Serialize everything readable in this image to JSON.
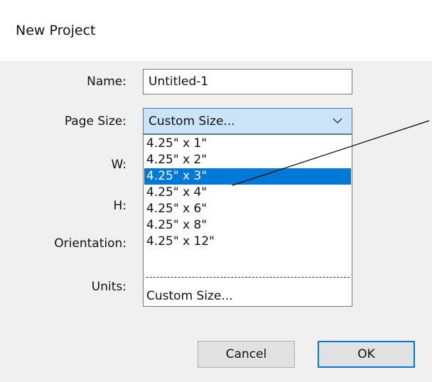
{
  "dialog": {
    "title": "New Project"
  },
  "form": {
    "name_label": "Name:",
    "name_value": "Untitled-1",
    "page_size_label": "Page Size:",
    "page_size_value": "Custom Size...",
    "w_label": "W:",
    "h_label": "H:",
    "orientation_label": "Orientation:",
    "units_label": "Units:"
  },
  "dropdown": {
    "items": [
      {
        "label": "4.25\" x 1\""
      },
      {
        "label": "4.25\" x 2\""
      },
      {
        "label": "4.25\" x 3\""
      },
      {
        "label": "4.25\" x 4\""
      },
      {
        "label": "4.25\" x 6\""
      },
      {
        "label": "4.25\" x 8\""
      },
      {
        "label": "4.25\" x 12\""
      }
    ],
    "selected_index": 2,
    "custom_label": "Custom Size..."
  },
  "buttons": {
    "cancel": "Cancel",
    "ok": "OK"
  },
  "colors": {
    "selection": "#0078d7",
    "combo_highlight": "#cce4f7"
  },
  "icons": {
    "dropdown_arrow": "chevron-down-icon"
  }
}
